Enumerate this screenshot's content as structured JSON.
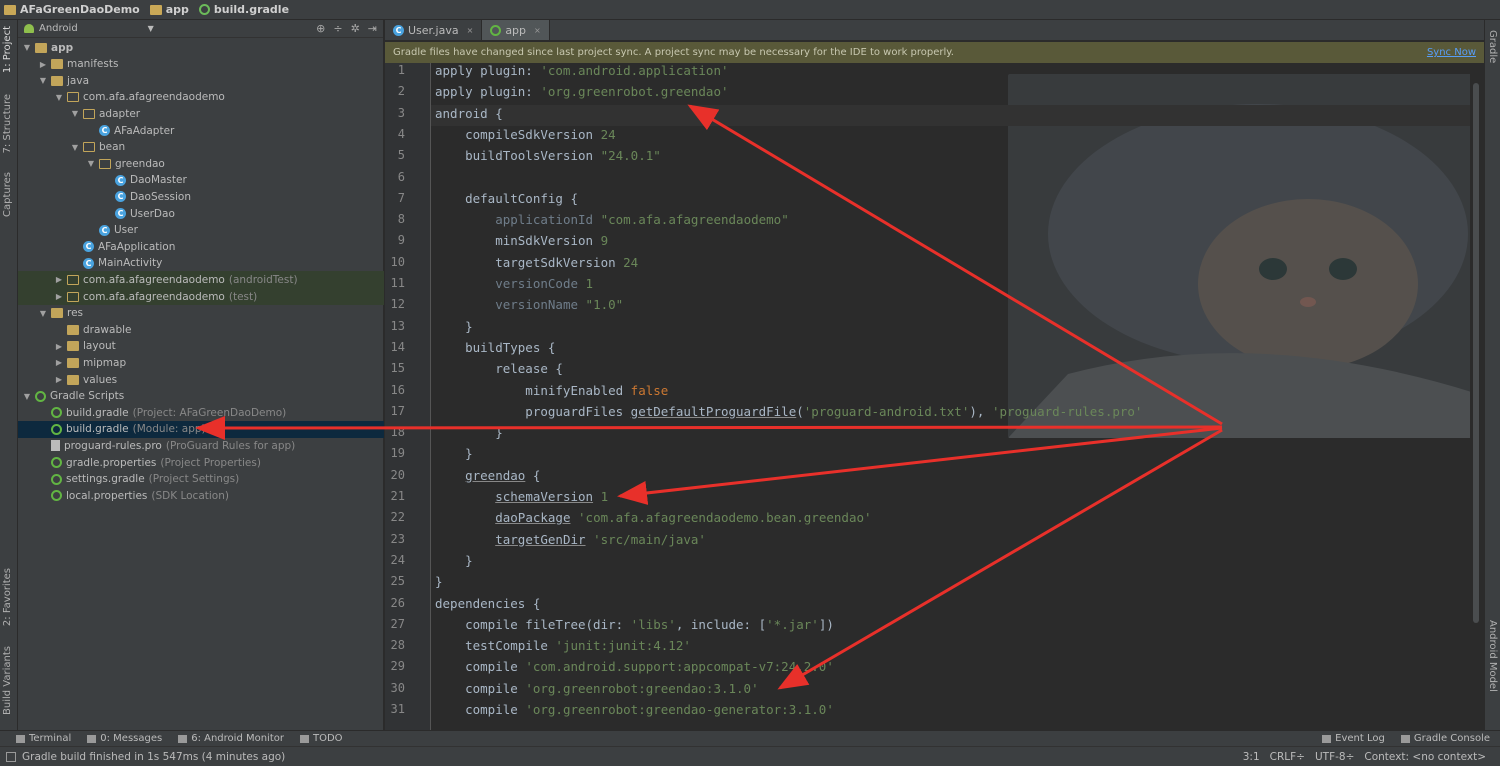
{
  "breadcrumb": [
    "AFaGreenDaoDemo",
    "app",
    "build.gradle"
  ],
  "left_strip": {
    "project": "1: Project",
    "structure": "7: Structure",
    "captures": "Captures",
    "favorites": "2: Favorites",
    "build_variants": "Build Variants"
  },
  "right_strip": {
    "gradle": "Gradle",
    "android_model": "Android Model"
  },
  "project_panel": {
    "view": "Android"
  },
  "tree": [
    {
      "label": "app",
      "sub": "",
      "depth": 0,
      "arrow": "▼",
      "icon": "folder",
      "bold": true
    },
    {
      "label": "manifests",
      "sub": "",
      "depth": 1,
      "arrow": "▶",
      "icon": "folder"
    },
    {
      "label": "java",
      "sub": "",
      "depth": 1,
      "arrow": "▼",
      "icon": "folder"
    },
    {
      "label": "com.afa.afagreendaodemo",
      "sub": "",
      "depth": 2,
      "arrow": "▼",
      "icon": "pkg"
    },
    {
      "label": "adapter",
      "sub": "",
      "depth": 3,
      "arrow": "▼",
      "icon": "pkg"
    },
    {
      "label": "AFaAdapter",
      "sub": "",
      "depth": 4,
      "arrow": "",
      "icon": "cls"
    },
    {
      "label": "bean",
      "sub": "",
      "depth": 3,
      "arrow": "▼",
      "icon": "pkg"
    },
    {
      "label": "greendao",
      "sub": "",
      "depth": 4,
      "arrow": "▼",
      "icon": "pkg"
    },
    {
      "label": "DaoMaster",
      "sub": "",
      "depth": 5,
      "arrow": "",
      "icon": "cls"
    },
    {
      "label": "DaoSession",
      "sub": "",
      "depth": 5,
      "arrow": "",
      "icon": "cls"
    },
    {
      "label": "UserDao",
      "sub": "",
      "depth": 5,
      "arrow": "",
      "icon": "cls"
    },
    {
      "label": "User",
      "sub": "",
      "depth": 4,
      "arrow": "",
      "icon": "cls"
    },
    {
      "label": "AFaApplication",
      "sub": "",
      "depth": 3,
      "arrow": "",
      "icon": "cls"
    },
    {
      "label": "MainActivity",
      "sub": "",
      "depth": 3,
      "arrow": "",
      "icon": "cls"
    },
    {
      "label": "com.afa.afagreendaodemo",
      "sub": "(androidTest)",
      "depth": 2,
      "arrow": "▶",
      "icon": "pkg",
      "band": true
    },
    {
      "label": "com.afa.afagreendaodemo",
      "sub": "(test)",
      "depth": 2,
      "arrow": "▶",
      "icon": "pkg",
      "band": true
    },
    {
      "label": "res",
      "sub": "",
      "depth": 1,
      "arrow": "▼",
      "icon": "folder"
    },
    {
      "label": "drawable",
      "sub": "",
      "depth": 2,
      "arrow": "",
      "icon": "folder"
    },
    {
      "label": "layout",
      "sub": "",
      "depth": 2,
      "arrow": "▶",
      "icon": "folder"
    },
    {
      "label": "mipmap",
      "sub": "",
      "depth": 2,
      "arrow": "▶",
      "icon": "folder"
    },
    {
      "label": "values",
      "sub": "",
      "depth": 2,
      "arrow": "▶",
      "icon": "folder"
    },
    {
      "label": "Gradle Scripts",
      "sub": "",
      "depth": 0,
      "arrow": "▼",
      "icon": "grd"
    },
    {
      "label": "build.gradle",
      "sub": "(Project: AFaGreenDaoDemo)",
      "depth": 1,
      "arrow": "",
      "icon": "grd"
    },
    {
      "label": "build.gradle",
      "sub": "(Module: app)",
      "depth": 1,
      "arrow": "",
      "icon": "grd",
      "selected": true
    },
    {
      "label": "proguard-rules.pro",
      "sub": "(ProGuard Rules for app)",
      "depth": 1,
      "arrow": "",
      "icon": "file"
    },
    {
      "label": "gradle.properties",
      "sub": "(Project Properties)",
      "depth": 1,
      "arrow": "",
      "icon": "grd"
    },
    {
      "label": "settings.gradle",
      "sub": "(Project Settings)",
      "depth": 1,
      "arrow": "",
      "icon": "grd"
    },
    {
      "label": "local.properties",
      "sub": "(SDK Location)",
      "depth": 1,
      "arrow": "",
      "icon": "grd"
    }
  ],
  "editor_tabs": [
    {
      "label": "User.java",
      "active": false
    },
    {
      "label": "app",
      "active": true
    }
  ],
  "banner": {
    "message": "Gradle files have changed since last project sync. A project sync may be necessary for the IDE to work properly.",
    "action": "Sync Now"
  },
  "code_lines": [
    {
      "n": "1",
      "html": "apply plugin: <span class='str'>'com.android.application'</span>"
    },
    {
      "n": "2",
      "html": "apply plugin: <span class='str'>'org.greenrobot.greendao'</span>"
    },
    {
      "n": "3",
      "html": "android {"
    },
    {
      "n": "4",
      "html": "    compileSdkVersion <span class='str'>24</span>"
    },
    {
      "n": "5",
      "html": "    buildToolsVersion <span class='str'>\"24.0.1\"</span>"
    },
    {
      "n": "6",
      "html": ""
    },
    {
      "n": "7",
      "html": "    defaultConfig {"
    },
    {
      "n": "8",
      "html": "        <span class='dim'>applicationId</span> <span class='str'>\"com.afa.afagreendaodemo\"</span>"
    },
    {
      "n": "9",
      "html": "        minSdkVersion <span class='str'>9</span>"
    },
    {
      "n": "10",
      "html": "        targetSdkVersion <span class='str'>24</span>"
    },
    {
      "n": "11",
      "html": "        <span class='dim'>versionCode</span> <span class='str'>1</span>"
    },
    {
      "n": "12",
      "html": "        <span class='dim'>versionName</span> <span class='str'>\"1.0\"</span>"
    },
    {
      "n": "13",
      "html": "    }"
    },
    {
      "n": "14",
      "html": "    buildTypes {"
    },
    {
      "n": "15",
      "html": "        release {"
    },
    {
      "n": "16",
      "html": "            minifyEnabled <span class='kw'>false</span>"
    },
    {
      "n": "17",
      "html": "            proguardFiles <span class='und'>getDefaultProguardFile</span>(<span class='str'>'proguard-android.txt'</span>), <span class='str'>'proguard-rules.pro'</span>"
    },
    {
      "n": "18",
      "html": "        }"
    },
    {
      "n": "19",
      "html": "    }"
    },
    {
      "n": "20",
      "html": "    <span class='und'>greendao</span> {"
    },
    {
      "n": "21",
      "html": "        <span class='und'>schemaVersion</span> <span class='str'>1</span>"
    },
    {
      "n": "22",
      "html": "        <span class='und'>daoPackage</span> <span class='str'>'com.afa.afagreendaodemo.bean.greendao'</span>"
    },
    {
      "n": "23",
      "html": "        <span class='und'>targetGenDir</span> <span class='str'>'src/main/java'</span>"
    },
    {
      "n": "24",
      "html": "    }"
    },
    {
      "n": "25",
      "html": "}"
    },
    {
      "n": "26",
      "html": "dependencies {"
    },
    {
      "n": "27",
      "html": "    compile fileTree(dir: <span class='str'>'libs'</span>, include: [<span class='str'>'*.jar'</span>])"
    },
    {
      "n": "28",
      "html": "    testCompile <span class='str'>'junit:junit:4.12'</span>"
    },
    {
      "n": "29",
      "html": "    compile <span class='str'>'com.android.support:appcompat-v7:24.2.0'</span>"
    },
    {
      "n": "30",
      "html": "    compile <span class='str'>'org.greenrobot:greendao:3.1.0'</span>"
    },
    {
      "n": "31",
      "html": "    compile <span class='str'>'org.greenrobot:greendao-generator:3.1.0'</span>"
    }
  ],
  "bottom_tools": [
    {
      "label": "Terminal",
      "key": ""
    },
    {
      "label": "0: Messages",
      "key": "0"
    },
    {
      "label": "6: Android Monitor",
      "key": "6"
    },
    {
      "label": "TODO",
      "key": ""
    }
  ],
  "bottom_right_tools": [
    "Event Log",
    "Gradle Console"
  ],
  "status": {
    "message": "Gradle build finished in 1s 547ms (4 minutes ago)",
    "position": "3:1",
    "line_sep": "CRLF÷",
    "encoding": "UTF-8÷",
    "context": "Context: <no context>"
  },
  "colors": {
    "arrow": "#e8302a",
    "selection": "#0d293e"
  }
}
